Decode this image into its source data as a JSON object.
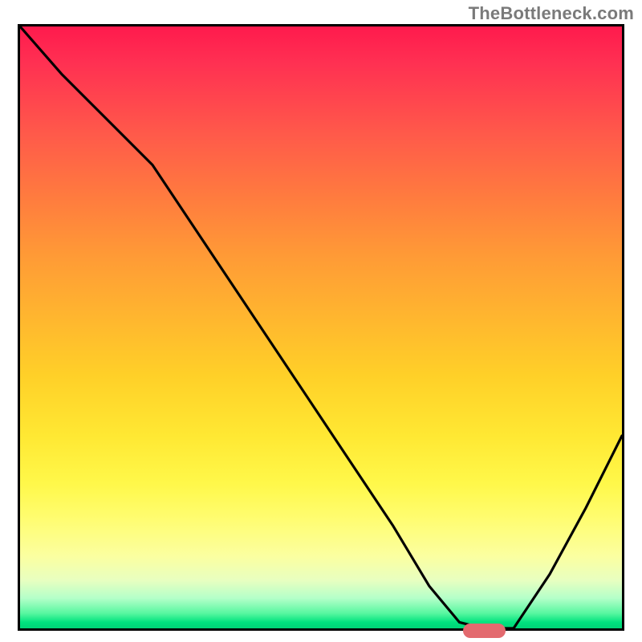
{
  "attribution": "TheBottleneck.com",
  "chart_data": {
    "type": "line",
    "title": "",
    "xlabel": "",
    "ylabel": "",
    "xlim": [
      0,
      100
    ],
    "ylim": [
      0,
      100
    ],
    "x": [
      0,
      7,
      15,
      22,
      30,
      38,
      46,
      54,
      62,
      68,
      73,
      77,
      82,
      88,
      94,
      100
    ],
    "values": [
      100,
      92,
      84,
      77,
      65,
      53,
      41,
      29,
      17,
      7,
      1,
      0,
      0,
      9,
      20,
      32
    ],
    "marker": {
      "x_start": 73,
      "x_end": 80,
      "y": 0
    },
    "gradient": {
      "top_color": "#ff1a4d",
      "mid_color": "#ffe833",
      "bottom_color": "#00d477"
    },
    "grid": false,
    "legend": false
  }
}
